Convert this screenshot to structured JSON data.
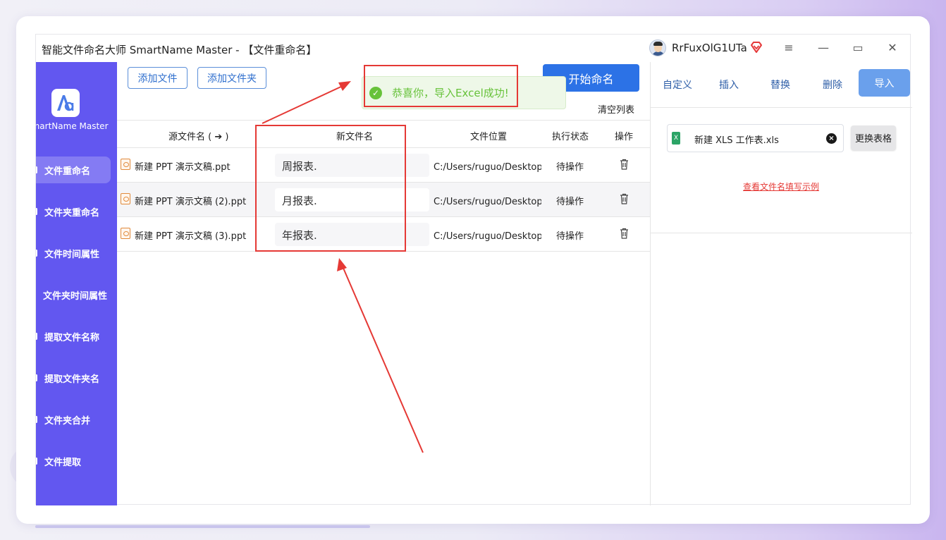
{
  "window": {
    "title": "智能文件命名大师 SmartName Master - 【文件重命名】",
    "username": "RrFuxOlG1UTa",
    "menu_glyph": "≡",
    "min_glyph": "—",
    "max_glyph": "▭",
    "close_glyph": "✕"
  },
  "sidebar": {
    "brand": "SmartName Master",
    "items": [
      {
        "label": "文件重命名"
      },
      {
        "label": "文件夹重命名"
      },
      {
        "label": "文件时间属性"
      },
      {
        "label": "文件夹时间属性"
      },
      {
        "label": "提取文件名称"
      },
      {
        "label": "提取文件夹名"
      },
      {
        "label": "文件夹合并"
      },
      {
        "label": "文件提取"
      }
    ]
  },
  "toolbar": {
    "add_file": "添加文件",
    "add_folder": "添加文件夹",
    "start": "开始命名",
    "clear_list": "清空列表"
  },
  "toast": {
    "message": "恭喜你，导入Excel成功!",
    "check_glyph": "✓"
  },
  "table": {
    "headers": {
      "source": "源文件名 ( ➔ )",
      "new_name": "新文件名",
      "location": "文件位置",
      "status": "执行状态",
      "action": "操作"
    },
    "rows": [
      {
        "source": "新建 PPT 演示文稿.ppt",
        "new_name": "周报表.",
        "location": "C:/Users/ruguo/Desktop/新",
        "status": "待操作"
      },
      {
        "source": "新建 PPT 演示文稿 (2).ppt",
        "new_name": "月报表.",
        "location": "C:/Users/ruguo/Desktop/新",
        "status": "待操作"
      },
      {
        "source": "新建 PPT 演示文稿 (3).ppt",
        "new_name": "年报表.",
        "location": "C:/Users/ruguo/Desktop/新",
        "status": "待操作"
      }
    ]
  },
  "right_panel": {
    "tabs": [
      "自定义",
      "插入",
      "替换",
      "删除"
    ],
    "import_tab": "导入",
    "xls_file": "新建 XLS 工作表.xls",
    "xls_icon_letter": "X",
    "clear_glyph": "×",
    "change_table": "更换表格",
    "example_link": "查看文件名填写示例"
  },
  "colors": {
    "sidebar": "#6257f0",
    "primary": "#2c72e6",
    "annotation": "#e53935",
    "success": "#67c23a"
  }
}
